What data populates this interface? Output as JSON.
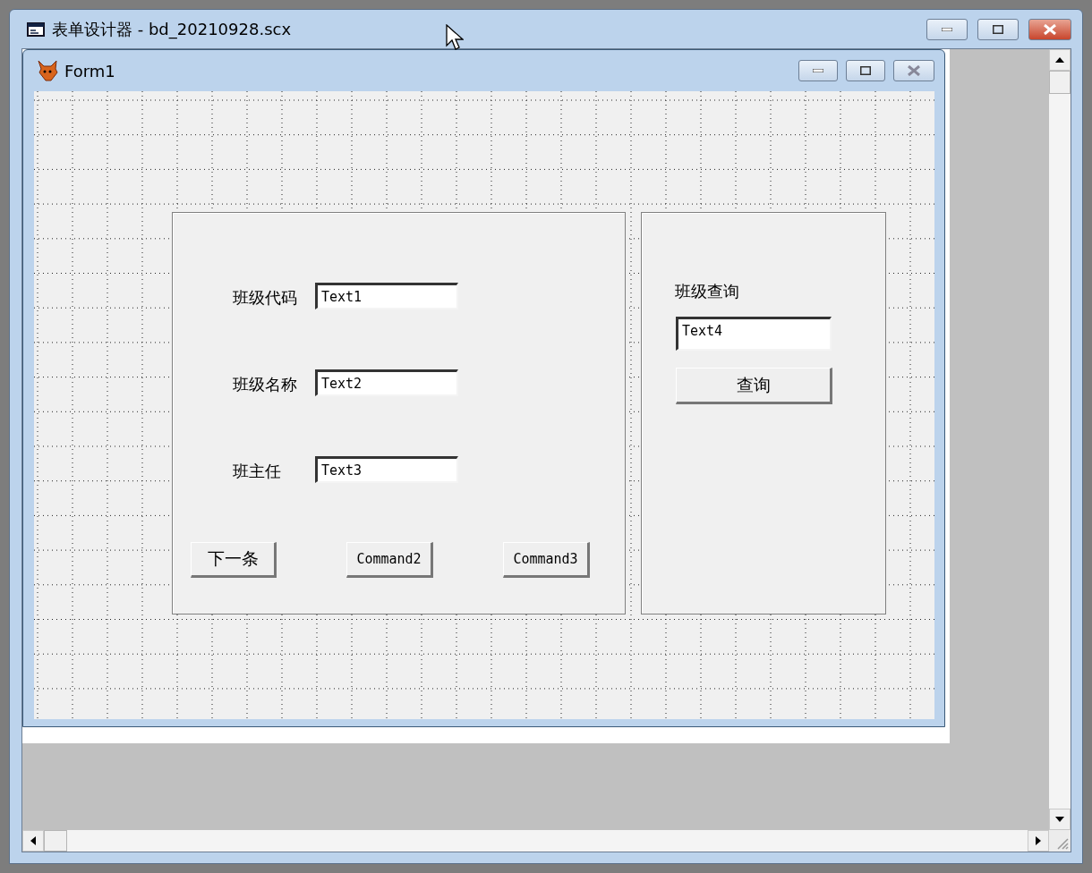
{
  "window": {
    "title": "表单设计器 - bd_20210928.scx"
  },
  "form": {
    "title": "Form1",
    "data_panel": {
      "fields": [
        {
          "label": "班级代码",
          "value": "Text1"
        },
        {
          "label": "班级名称",
          "value": "Text2"
        },
        {
          "label": "班主任",
          "value": "Text3"
        }
      ],
      "buttons": [
        "下一条",
        "Command2",
        "Command3"
      ]
    },
    "query_panel": {
      "label": "班级查询",
      "field": "Text4",
      "button": "查询"
    }
  }
}
